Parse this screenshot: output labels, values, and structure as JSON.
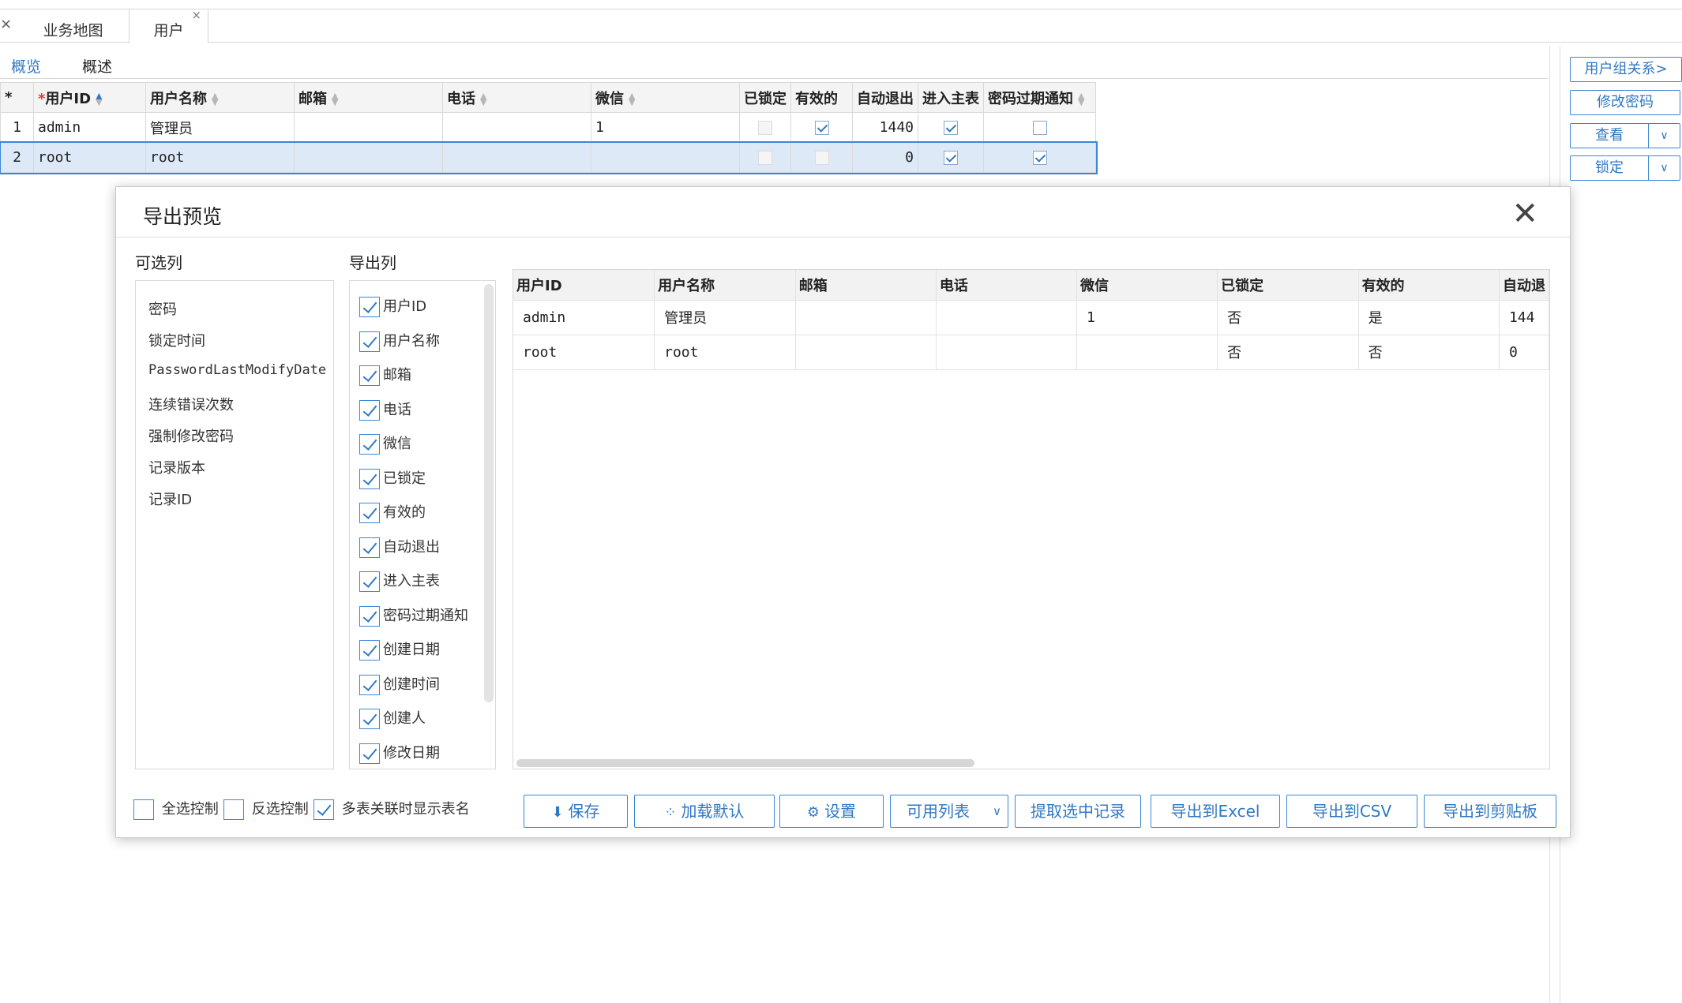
{
  "tabs": {
    "close_glyph": "×",
    "items": [
      "业务地图",
      "用户"
    ],
    "active_close": "×"
  },
  "subtabs": [
    "概览",
    "概述"
  ],
  "grid": {
    "corner": "*",
    "headers": {
      "user_id": "用户ID",
      "user_name": "用户名称",
      "email": "邮箱",
      "phone": "电话",
      "wechat": "微信",
      "locked": "已锁定",
      "valid": "有效的",
      "auto_logout": "自动退出",
      "enter_main": "进入主表",
      "pwd_notice": "密码过期通知"
    },
    "required_mark": "*",
    "rows": [
      {
        "no": "1",
        "user_id": "admin",
        "user_name": "管理员",
        "email": "",
        "phone": "",
        "wechat": "1",
        "locked": false,
        "valid": true,
        "auto_logout": "1440",
        "enter_main": true,
        "pwd_notice": false
      },
      {
        "no": "2",
        "user_id": "root",
        "user_name": "root",
        "email": "",
        "phone": "",
        "wechat": "",
        "locked": false,
        "valid": false,
        "auto_logout": "0",
        "enter_main": true,
        "pwd_notice": true
      }
    ]
  },
  "right_buttons": {
    "group": "用户组关系>",
    "change_pwd": "修改密码",
    "view": "查看",
    "lock": "锁定",
    "dropdown": "∨"
  },
  "dialog": {
    "title": "导出预览",
    "close": "✕",
    "available_label": "可选列",
    "export_label": "导出列",
    "available": [
      "密码",
      "锁定时间",
      "PasswordLastModifyDate",
      "连续错误次数",
      "强制修改密码",
      "记录版本",
      "记录ID"
    ],
    "export_columns": [
      "用户ID",
      "用户名称",
      "邮箱",
      "电话",
      "微信",
      "已锁定",
      "有效的",
      "自动退出",
      "进入主表",
      "密码过期通知",
      "创建日期",
      "创建时间",
      "创建人",
      "修改日期"
    ],
    "preview": {
      "headers": [
        "用户ID",
        "用户名称",
        "邮箱",
        "电话",
        "微信",
        "已锁定",
        "有效的",
        "自动退"
      ],
      "rows": [
        [
          "admin",
          "管理员",
          "",
          "",
          "1",
          "否",
          "是",
          "144"
        ],
        [
          "root",
          "root",
          "",
          "",
          "",
          "否",
          "否",
          "0"
        ]
      ]
    },
    "footer": {
      "select_all": "全选控制",
      "invert": "反选控制",
      "show_table_name": "多表关联时显示表名",
      "save": "保存",
      "load_default": "加载默认",
      "settings": "设置",
      "available_list": "可用列表",
      "fetch_selected": "提取选中记录",
      "export_excel": "导出到Excel",
      "export_csv": "导出到CSV",
      "export_clipboard": "导出到剪贴板"
    }
  }
}
